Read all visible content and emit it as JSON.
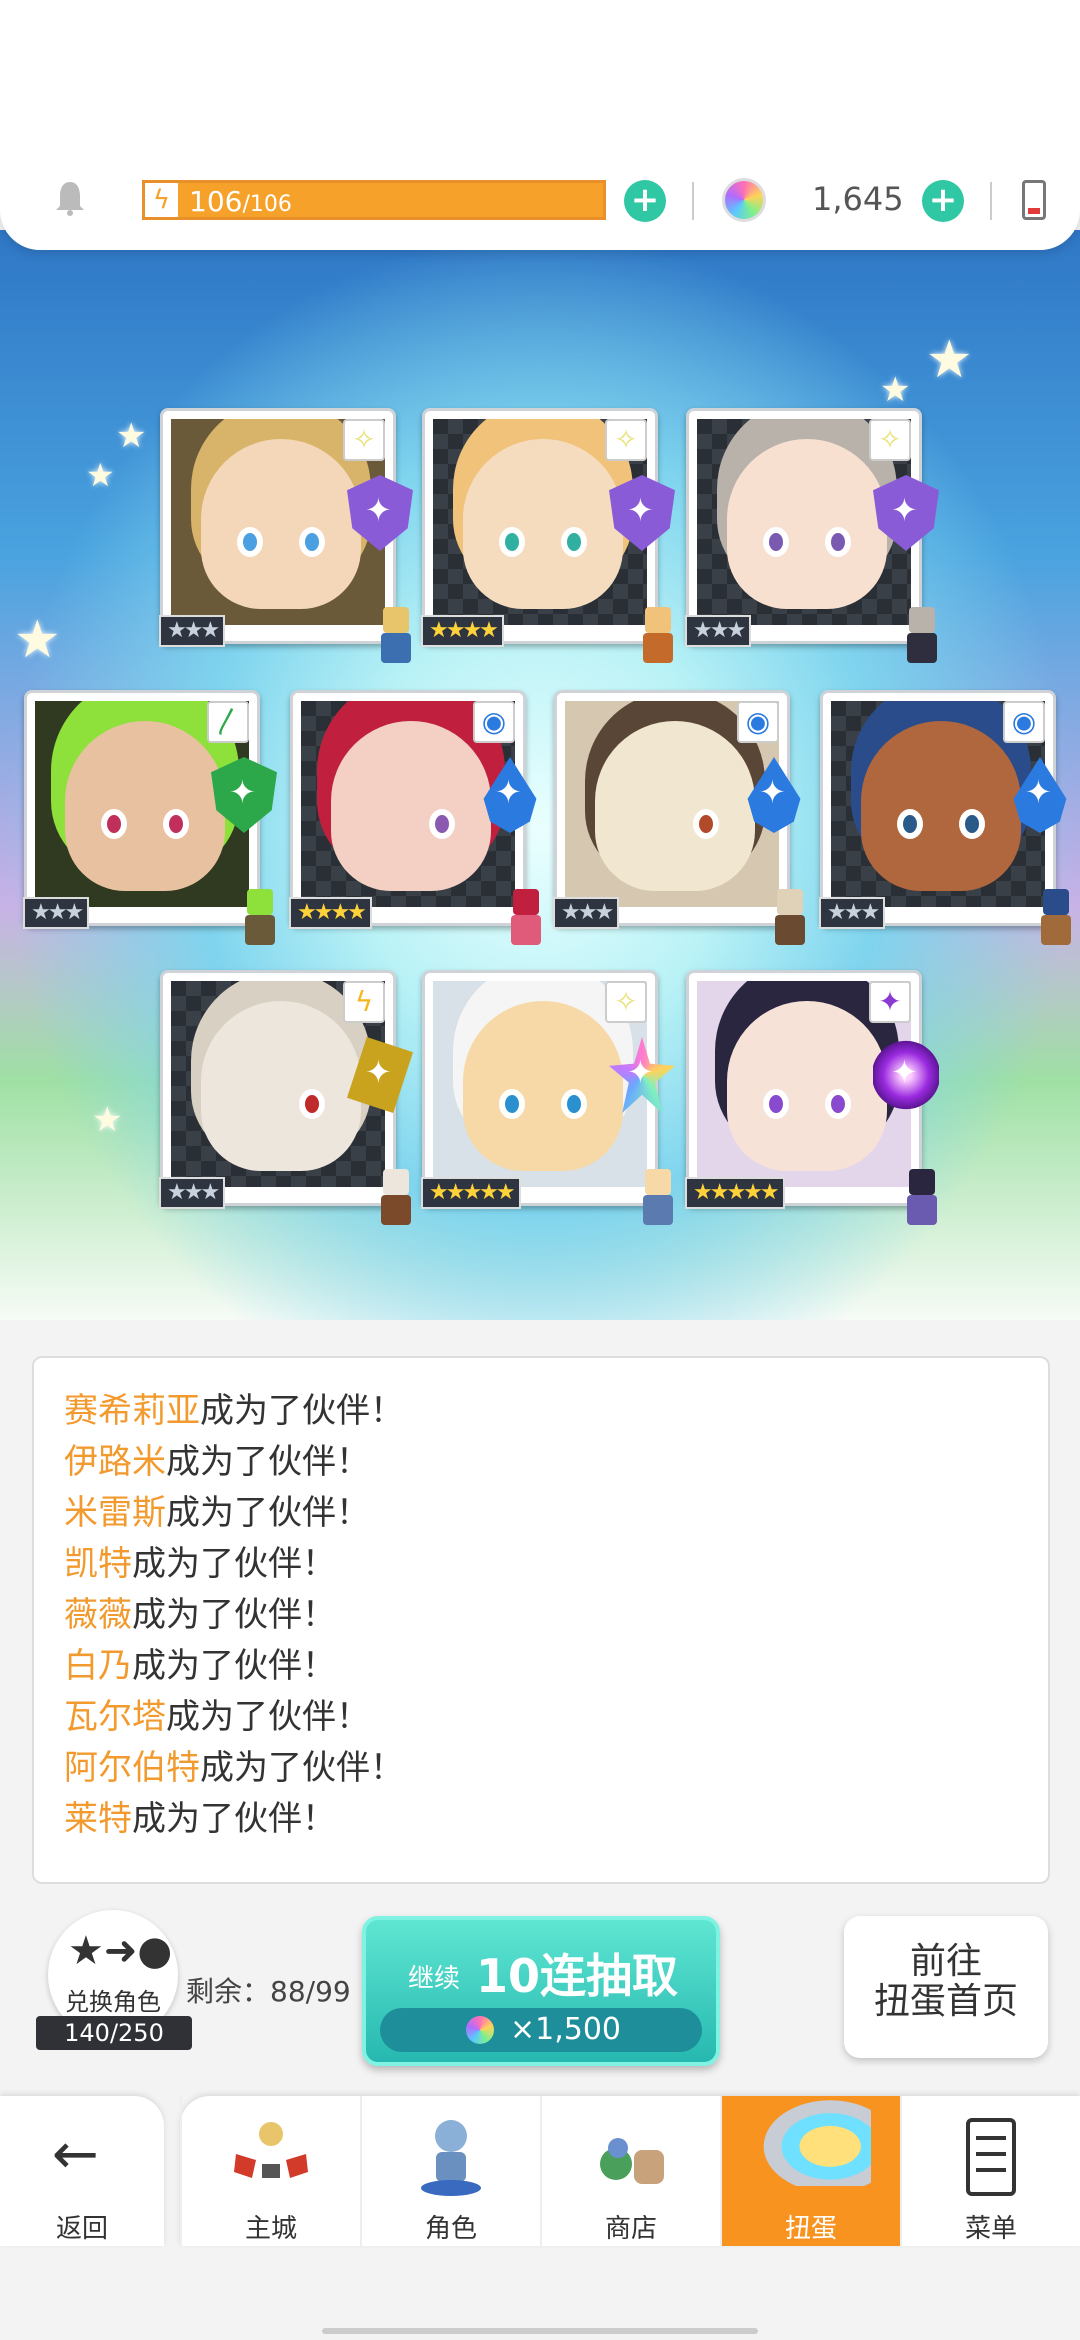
{
  "status": {
    "stamina_current": "106",
    "stamina_max": "/106",
    "currency": "1,645",
    "icons": [
      "bell-icon",
      "bolt-icon",
      "plus-icon",
      "gem-icon",
      "battery-icon"
    ]
  },
  "results": [
    {
      "stars": "★★★",
      "element": "light"
    },
    {
      "stars": "★★★★",
      "element": "light"
    },
    {
      "stars": "★★★",
      "element": "light"
    },
    {
      "stars": "★★★",
      "element": "wind"
    },
    {
      "stars": "★★★★",
      "element": "water"
    },
    {
      "stars": "★★★",
      "element": "water"
    },
    {
      "stars": "★★★",
      "element": "water"
    },
    {
      "stars": "★★★",
      "element": "thunder"
    },
    {
      "stars": "★★★★★",
      "element": "light"
    },
    {
      "stars": "★★★★★",
      "element": "dark"
    }
  ],
  "log": {
    "suffix": "成为了伙伴！",
    "names": [
      "赛希莉亚",
      "伊路米",
      "米雷斯",
      "凯特",
      "薇薇",
      "白乃",
      "瓦尔塔",
      "阿尔伯特",
      "莱特"
    ]
  },
  "actions": {
    "exchange_label": "兑换角色",
    "exchange_count": "140/250",
    "remaining": "剩余：88/99",
    "summon_continue": "继续",
    "summon_label": "10连抽取",
    "summon_cost": "×1,500",
    "goto_line1": "前往",
    "goto_line2": "扭蛋首页"
  },
  "nav": {
    "back": "返回",
    "tabs": [
      {
        "label": "主城",
        "icon": "castle-icon",
        "active": false
      },
      {
        "label": "角色",
        "icon": "character-icon",
        "active": false
      },
      {
        "label": "商店",
        "icon": "shop-icon",
        "active": false
      },
      {
        "label": "扭蛋",
        "icon": "gacha-icon",
        "active": true
      },
      {
        "label": "菜单",
        "icon": "menu-icon",
        "active": false
      }
    ]
  },
  "colors": {
    "accent_orange": "#f7931e",
    "name_orange": "#f29a2e",
    "teal": "#2fc7a4"
  }
}
